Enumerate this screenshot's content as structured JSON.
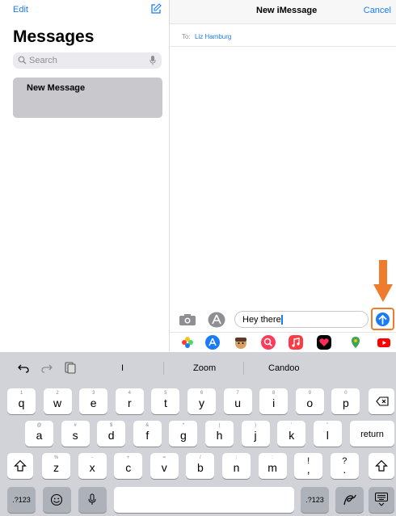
{
  "sidebar": {
    "edit_label": "Edit",
    "title": "Messages",
    "search_placeholder": "Search",
    "new_message_label": "New Message"
  },
  "conversation": {
    "title": "New iMessage",
    "cancel_label": "Cancel",
    "to_label": "To:",
    "recipient": "Liz Hamburg"
  },
  "composer": {
    "text": "Hey there!"
  },
  "keyboard": {
    "suggestions": [
      "I",
      "Zoom",
      "Candoo"
    ],
    "row1": [
      [
        "1",
        "q"
      ],
      [
        "2",
        "w"
      ],
      [
        "3",
        "e"
      ],
      [
        "4",
        "r"
      ],
      [
        "5",
        "t"
      ],
      [
        "6",
        "y"
      ],
      [
        "7",
        "u"
      ],
      [
        "8",
        "i"
      ],
      [
        "9",
        "o"
      ],
      [
        "0",
        "p"
      ]
    ],
    "row2": [
      [
        "@",
        "a"
      ],
      [
        "#",
        "s"
      ],
      [
        "$",
        "d"
      ],
      [
        "&",
        "f"
      ],
      [
        "*",
        "g"
      ],
      [
        "(",
        "h"
      ],
      [
        ")",
        "j"
      ],
      [
        "'",
        "k"
      ],
      [
        "\"",
        "l"
      ]
    ],
    "row3": [
      [
        "%",
        "z"
      ],
      [
        "-",
        "x"
      ],
      [
        "+",
        "c"
      ],
      [
        "=",
        "v"
      ],
      [
        "/",
        "b"
      ],
      [
        ";",
        "n"
      ],
      [
        ":",
        "m"
      ],
      [
        "!",
        ","
      ],
      [
        "?",
        "."
      ]
    ],
    "return_label": "return",
    "numbers_label": ".?123"
  },
  "colors": {
    "accent": "#1a7cf5",
    "highlight": "#ef7b2c"
  }
}
